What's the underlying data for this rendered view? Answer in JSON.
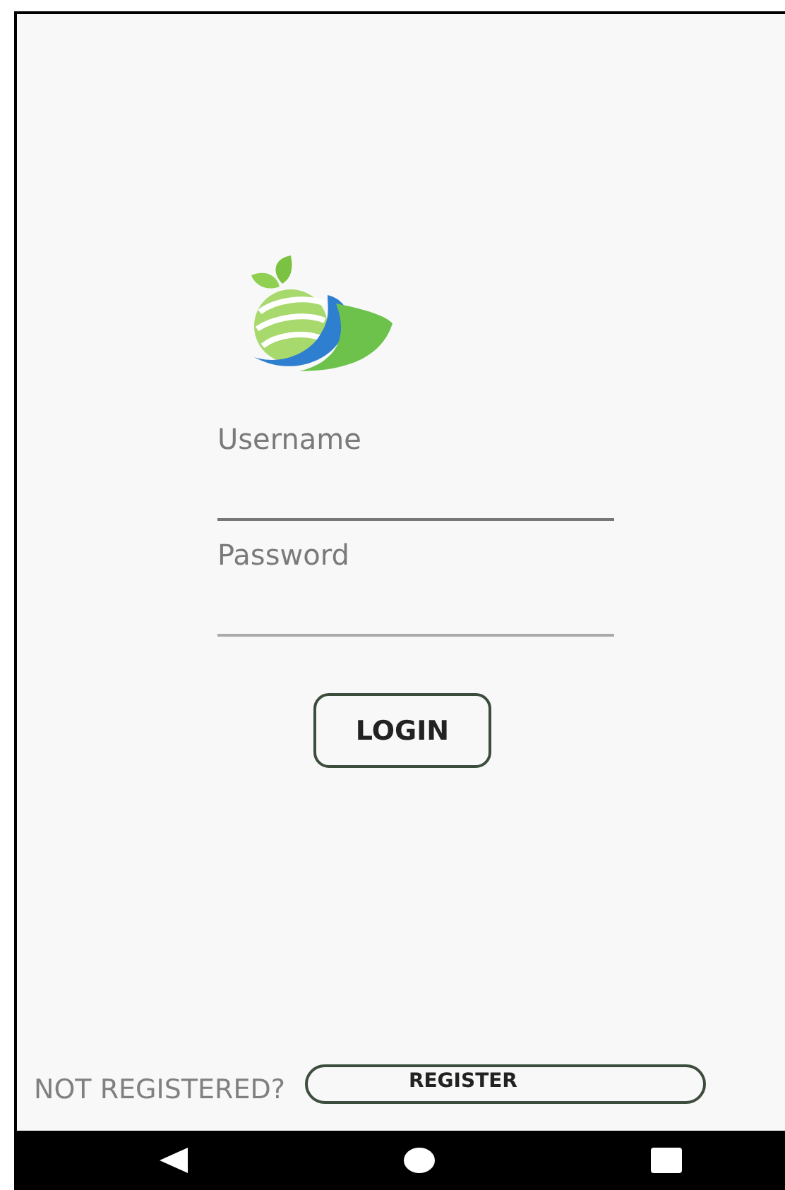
{
  "login_form": {
    "fields": [
      {
        "placeholder": "Username"
      },
      {
        "placeholder": "Password"
      }
    ],
    "login_button": "LOGIN"
  },
  "footer": {
    "prompt": "NOT REGISTERED?",
    "register_button": "REGISTER"
  }
}
